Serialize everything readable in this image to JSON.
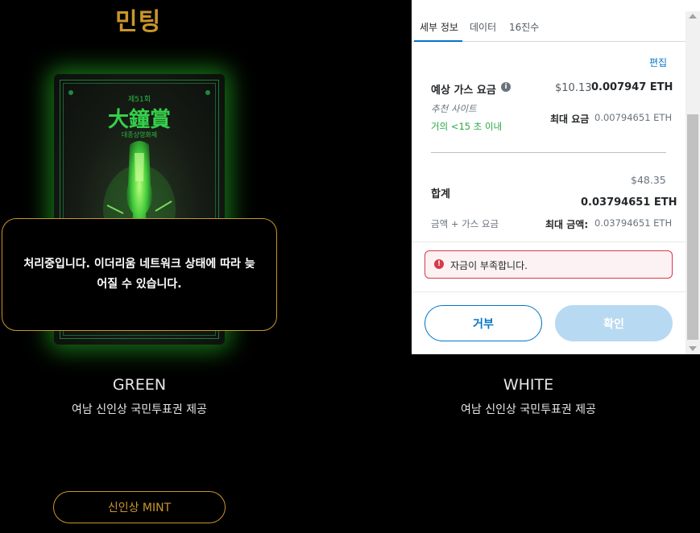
{
  "page": {
    "title": "민팅"
  },
  "cards": [
    {
      "name": "GREEN",
      "desc": "여남 신인상 국민투표권 제공",
      "card_number": "제51회",
      "card_title": "大鐘賞",
      "card_sub": "대종상영화제"
    },
    {
      "name": "WHITE",
      "desc": "여남 신인상 국민투표권 제공"
    }
  ],
  "mint_button": "신인상 MINT",
  "toast": {
    "message": "처리중입니다. 이더리움 네트워크 상태에 따라 늦어질 수 있습니다."
  },
  "wallet": {
    "tabs": [
      "세부 정보",
      "데이터",
      "16진수"
    ],
    "active_tab": "세부 정보",
    "edit_label": "편집",
    "gas": {
      "label": "예상 가스 요금",
      "info_icon": "i",
      "fiat": "$10.13",
      "eth": "0.007947 ETH",
      "suggestion": "추천 사이트",
      "eta": "거의 <15 초 이내",
      "max_label": "최대 요금",
      "max_value": "0.00794651 ETH"
    },
    "total": {
      "label": "합계",
      "fiat": "$48.35",
      "eth": "0.03794651 ETH",
      "sub_label": "금액 + 가스 요금",
      "max_label": "최대 금액:",
      "max_value": "0.03794651 ETH"
    },
    "error": {
      "icon": "!",
      "text": "자금이 부족합니다."
    },
    "reject_label": "거부",
    "confirm_label": "확인",
    "colors": {
      "accent": "#0376c9",
      "success": "#28a745",
      "error": "#d73a49",
      "gold": "#c8962b"
    }
  }
}
